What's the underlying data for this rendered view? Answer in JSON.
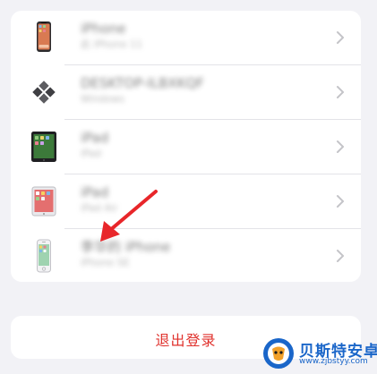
{
  "devices": [
    {
      "name": "iPhone",
      "model": "此 iPhone 11",
      "icon": "iphone-icon"
    },
    {
      "name": "DESKTOP-ILBXKQF",
      "model": "Windows",
      "icon": "windows-icon"
    },
    {
      "name": "iPad",
      "model": "iPad",
      "icon": "ipad-icon"
    },
    {
      "name": "iPad",
      "model": "iPad Air",
      "icon": "ipad-icon"
    },
    {
      "name": "李华的 iPhone",
      "model": "iPhone SE",
      "icon": "iphone-old-icon"
    }
  ],
  "signout": {
    "label": "退出登录"
  },
  "watermark": {
    "title": "贝斯特安卓网",
    "url": "www.zjbstyy.com"
  },
  "colors": {
    "background": "#f2f2f6",
    "card": "#ffffff",
    "signout_text": "#e0322d",
    "annotation_arrow": "#e8262a",
    "watermark_blue": "#1a66c9"
  }
}
